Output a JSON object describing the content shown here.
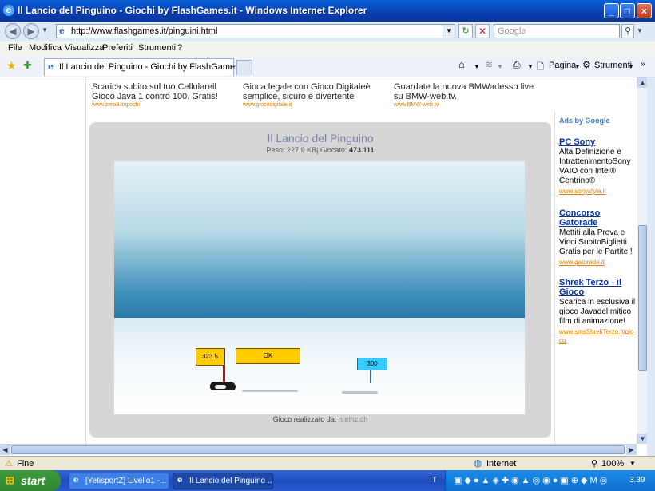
{
  "window": {
    "title": "Il Lancio del Pinguino - Giochi by FlashGames.it - Windows Internet Explorer"
  },
  "address": {
    "url": "http://www.flashgames.it/pinguini.html",
    "search_placeholder": "Google"
  },
  "menu": [
    "File",
    "Modifica",
    "Visualizza",
    "Preferiti",
    "Strumenti",
    "?"
  ],
  "tab": {
    "label": "Il Lancio del Pinguino - Giochi by FlashGames.it"
  },
  "toolbar": {
    "page_label": "Pagina",
    "tools_label": "Strumenti"
  },
  "top_ads": [
    {
      "text": "Scarica subito sul tuo Cellulareil Gioco Java 1 contro 100. Gratis!",
      "url": "www.zero9.it/giochi"
    },
    {
      "text": "Gioca legale con Gioco Digitaleè semplice, sicuro e divertente",
      "url": "www.giocodigitale.it"
    },
    {
      "text": "Guardate la nuova BMWadesso live su BMW-web.tv.",
      "url": "www.BMW-web.tv"
    }
  ],
  "game": {
    "title": "Il Lancio del Pinguino",
    "meta_prefix": "Peso: 227.9 KB| Giocato:",
    "meta_count": "473.111",
    "score_sign": "323.5",
    "ok_sign": "OK",
    "marker_300": "300",
    "credit_prefix": "Gioco realizzato da:",
    "credit_author": "n.ethz.ch"
  },
  "sidebar": {
    "header": "Ads by Google",
    "ads": [
      {
        "title": "PC Sony",
        "desc": "Alta Definizione e IntrattenimentoSony VAIO con Intel® Centrino®",
        "url": "www.sonystyle.it"
      },
      {
        "title": "Concorso Gatorade",
        "desc": "Mettiti alla Prova e Vinci SubitoBiglietti Gratis per le Partite !",
        "url": "www.gatorade.it"
      },
      {
        "title": "Shrek Terzo - il Gioco",
        "desc": "Scarica in esclusiva il gioco Javadel mitico film di animazione!",
        "url": "www.smsShrekTerzo.it/gioco"
      }
    ]
  },
  "status": {
    "left": "Fine",
    "zone": "Internet",
    "zoom": "100%"
  },
  "taskbar": {
    "start": "start",
    "tasks": [
      "[YetisportZ] Livello1 -...",
      "Il Lancio del Pinguino ..."
    ],
    "lang": "IT",
    "clock": "3.39"
  },
  "colors": {
    "titlebar": "#0a4fc8",
    "sky": "#3e8fba",
    "sign": "#ffcc00",
    "marker": "#33ccff",
    "ad_url": "#e08000",
    "ad_title": "#0033aa"
  }
}
